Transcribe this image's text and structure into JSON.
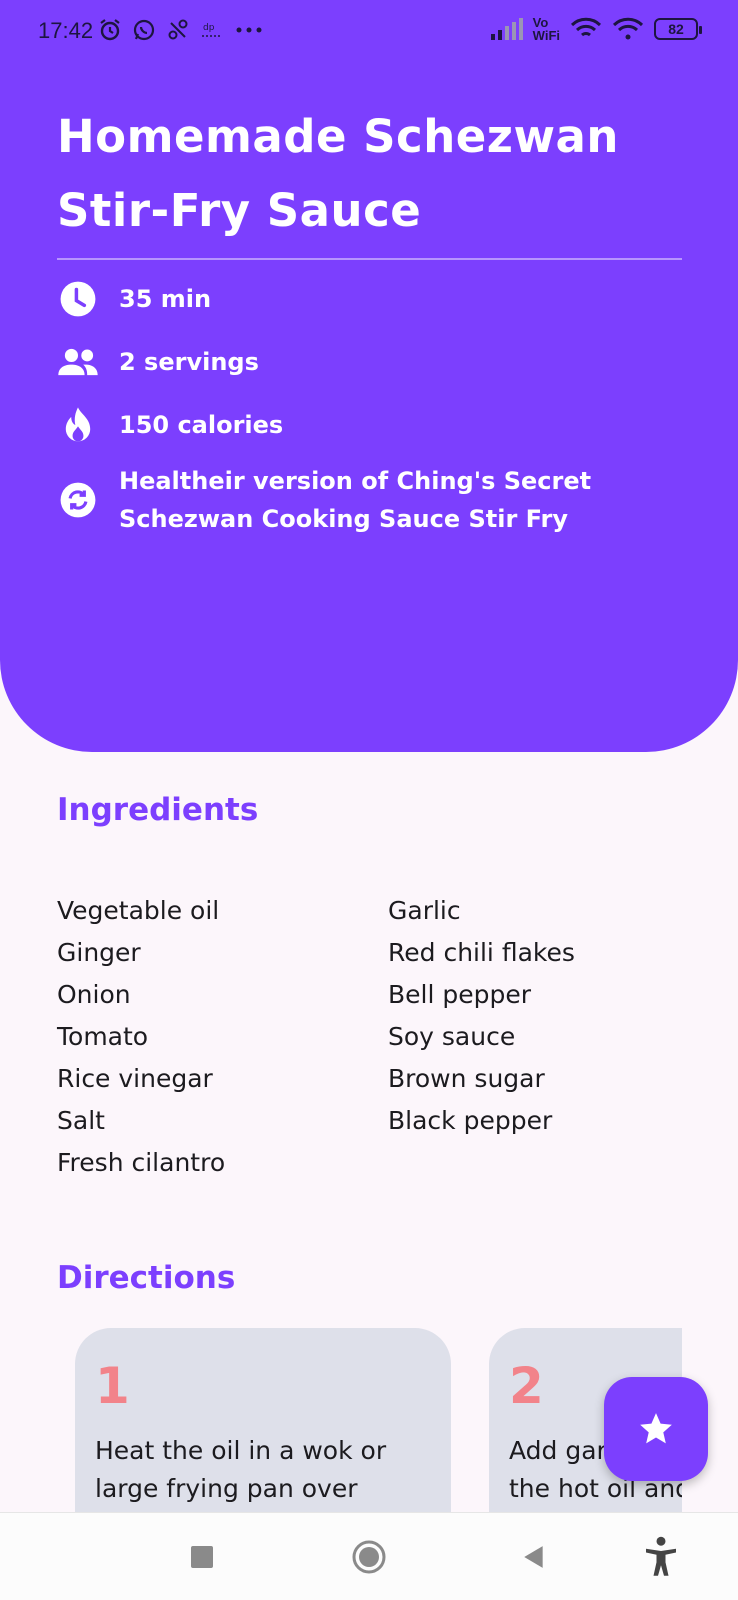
{
  "status_bar": {
    "time": "17:42",
    "vowifi": "Vo\nWiFi",
    "battery": "82"
  },
  "recipe": {
    "title": "Homemade Schezwan Stir-Fry Sauce",
    "time": "35 min",
    "servings": "2 servings",
    "calories": "150 calories",
    "description": "Healtheir version of Ching's Secret Schezwan Cooking Sauce Stir Fry"
  },
  "ingredients": {
    "heading": "Ingredients",
    "left": [
      "Vegetable oil",
      "Ginger",
      "Onion",
      "Tomato",
      "Rice vinegar",
      "Salt",
      "Fresh cilantro"
    ],
    "right": [
      "Garlic",
      "Red chili flakes",
      "Bell pepper",
      "Soy sauce",
      "Brown sugar",
      "Black pepper"
    ]
  },
  "directions": {
    "heading": "Directions",
    "steps": [
      {
        "number": "1",
        "text": "Heat the oil in a wok or large frying pan over medium heat."
      },
      {
        "number": "2",
        "text": "Add garlic and ginger to the hot oil and stir."
      }
    ]
  },
  "colors": {
    "primary": "#7c3ffe",
    "background": "#fcf6fb",
    "card": "#dee0ea",
    "step_number": "#f2838a"
  },
  "icons": {
    "time": "clock-icon",
    "servings": "people-icon",
    "calories": "flame-icon",
    "description": "sync-icon",
    "fab": "star-icon"
  }
}
